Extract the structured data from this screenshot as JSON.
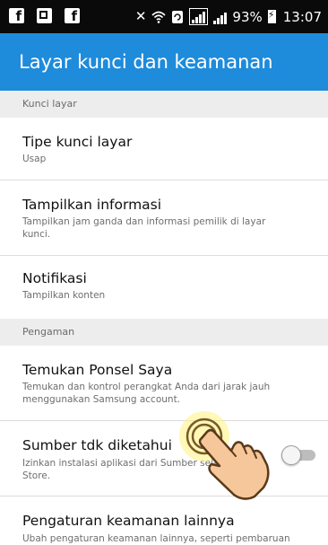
{
  "status_bar": {
    "left_icons": [
      "facebook-icon",
      "gallery-icon",
      "facebook-icon"
    ],
    "right_icons": [
      "mute-icon",
      "wifi-icon",
      "data-sync-icon",
      "signal-icon",
      "signal-icon",
      "battery-charging-icon"
    ],
    "battery": "93%",
    "time": "13:07"
  },
  "app_bar": {
    "title": "Layar kunci dan keamanan",
    "color": "#1e8bdb"
  },
  "sections": [
    {
      "header": "Kunci layar"
    },
    {
      "header": "Pengaman"
    }
  ],
  "items": [
    {
      "title": "Tipe kunci layar",
      "subtitle": "Usap"
    },
    {
      "title": "Tampilkan informasi",
      "subtitle": "Tampilkan jam ganda dan informasi pemilik di layar kunci."
    },
    {
      "title": "Notifikasi",
      "subtitle": "Tampilkan konten"
    },
    {
      "title": "Temukan Ponsel Saya",
      "subtitle": "Temukan dan kontrol perangkat Anda dari jarak jauh menggunakan Samsung account."
    },
    {
      "title": "Sumber tdk diketahui",
      "subtitle": "Izinkan instalasi aplikasi dari Sumber selain Play Store.",
      "toggle_on": false
    },
    {
      "title": "Pengaturan keamanan lainnya",
      "subtitle": "Ubah pengaturan keamanan lainnya, seperti pembaruan"
    }
  ]
}
